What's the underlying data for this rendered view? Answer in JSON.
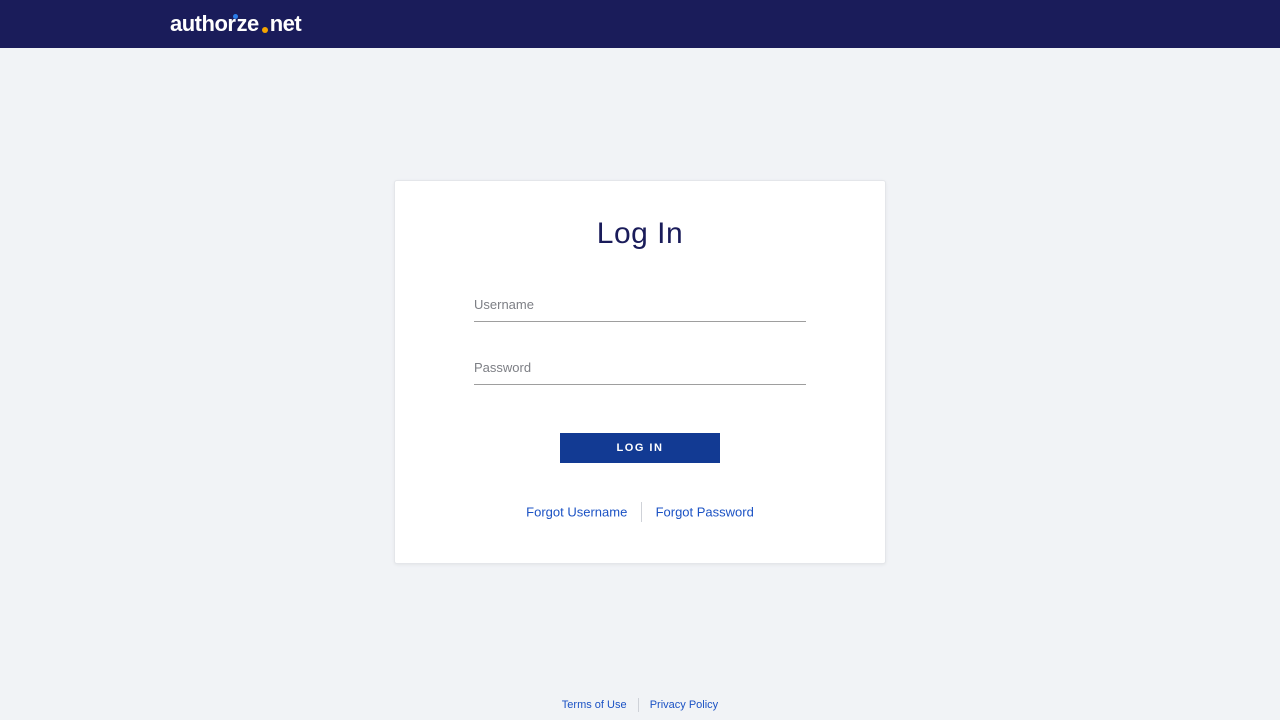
{
  "brand": {
    "part1": "author",
    "part2": "ze",
    "part3": "net"
  },
  "card": {
    "title": "Log In",
    "username_label": "Username",
    "username_value": "",
    "password_label": "Password",
    "password_value": "",
    "submit_label": "LOG IN",
    "forgot_username": "Forgot Username",
    "forgot_password": "Forgot Password"
  },
  "footer": {
    "terms": "Terms of Use",
    "privacy": "Privacy Policy"
  }
}
